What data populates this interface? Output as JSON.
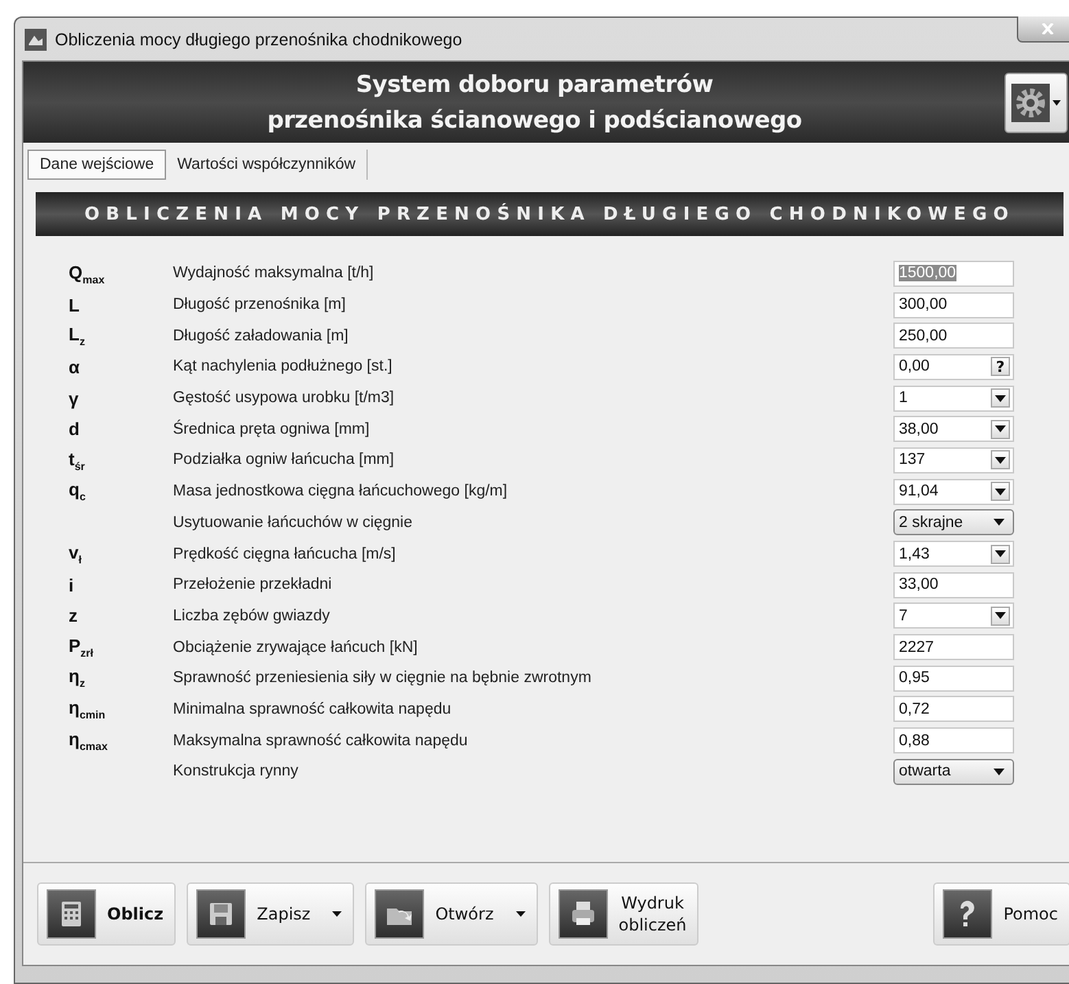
{
  "window": {
    "title": "Obliczenia mocy długiego przenośnika chodnikowego"
  },
  "header": {
    "title_line_1": "System doboru parametrów",
    "title_line_2": "przenośnika ścianowego i podścianowego"
  },
  "tabs": [
    {
      "label": "Dane wejściowe",
      "selected": true
    },
    {
      "label": "Wartości współczynników",
      "selected": false
    }
  ],
  "banner": "OBLICZENIA MOCY PRZENOŚNIKA DŁUGIEGO CHODNIKOWEGO",
  "rows": [
    {
      "symbol": "Q$_{max}$",
      "label": "Wydajność maksymalna [t/h]",
      "value": "1500,00",
      "kind": "text",
      "highlighted": true
    },
    {
      "symbol": "L",
      "label": "Długość przenośnika [m]",
      "value": "300,00",
      "kind": "text",
      "highlighted": false
    },
    {
      "symbol": "L$_{z}$",
      "label": "Długość załadowania [m]",
      "value": "250,00",
      "kind": "text",
      "highlighted": false
    },
    {
      "symbol": "α",
      "label": "Kąt nachylenia podłużnego [st.]",
      "value": "0,00",
      "kind": "help",
      "help": "?",
      "highlighted": false
    },
    {
      "symbol": "γ",
      "label": "Gęstość usypowa urobku [t/m3]",
      "value": "1",
      "kind": "combo",
      "highlighted": false
    },
    {
      "symbol": "d",
      "label": "Średnica pręta ogniwa [mm]",
      "value": "38,00",
      "kind": "combo",
      "highlighted": false
    },
    {
      "symbol": "t$_{śr}$",
      "label": "Podziałka ogniw łańcucha [mm]",
      "value": "137",
      "kind": "combo",
      "highlighted": false
    },
    {
      "symbol": "q$_{c}$",
      "label": "Masa jednostkowa cięgna łańcuchowego [kg/m]",
      "value": "91,04",
      "kind": "combo",
      "highlighted": false
    },
    {
      "label": "Usytuowanie łańcuchów w cięgnie",
      "value": "2 skrajne",
      "kind": "dropdown",
      "highlighted": false
    },
    {
      "symbol": "v$_{ł}$",
      "label": "Prędkość cięgna łańcucha [m/s]",
      "value": "1,43",
      "kind": "combo",
      "highlighted": false
    },
    {
      "symbol": "i",
      "label": "Przełożenie przekładni",
      "value": "33,00",
      "kind": "text",
      "highlighted": false
    },
    {
      "symbol": "z",
      "label": "Liczba zębów gwiazdy",
      "value": "7",
      "kind": "combo",
      "highlighted": false
    },
    {
      "symbol": "P$_{zrł}$",
      "label": "Obciążenie zrywające łańcuch [kN]",
      "value": "2227",
      "kind": "text",
      "highlighted": false
    },
    {
      "symbol": "η$_{z}$",
      "label": "Sprawność przeniesienia siły w cięgnie na bębnie zwrotnym",
      "value": "0,95",
      "kind": "text",
      "highlighted": false
    },
    {
      "symbol": "η$_{cmin}$",
      "label": "Minimalna sprawność całkowita napędu",
      "value": "0,72",
      "kind": "text",
      "highlighted": false
    },
    {
      "symbol": "η$_{cmax}$",
      "label": "Maksymalna sprawność całkowita napędu",
      "value": "0,88",
      "kind": "text",
      "highlighted": false
    },
    {
      "label": "Konstrukcja rynny",
      "value": "otwarta",
      "kind": "dropdown",
      "highlighted": false
    }
  ],
  "buttons": [
    {
      "label": "Oblicz",
      "kind": "calculate",
      "caret": false,
      "default": true
    },
    {
      "label": "Zapisz",
      "kind": "save",
      "caret": true,
      "default": false
    },
    {
      "label": "Otwórz",
      "kind": "open",
      "caret": true,
      "default": false
    },
    {
      "label": "Wydruk obliczeń",
      "kind": "print",
      "caret": false,
      "default": false
    },
    {
      "label": "Pomoc",
      "kind": "help",
      "caret": false,
      "default": false
    }
  ]
}
